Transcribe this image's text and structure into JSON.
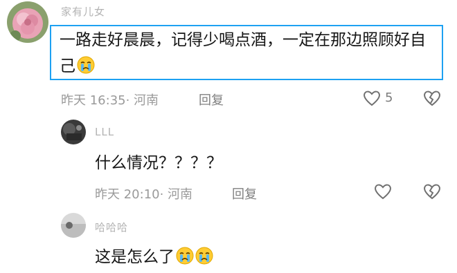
{
  "comment": {
    "username": "家有儿女",
    "text": "一路走好晨晨，记得少喝点酒，一定在那边照顾好自己",
    "time": "昨天 16:35",
    "location": "· 河南",
    "reply_label": "回复",
    "like_count": "5",
    "emoji": "crying-face"
  },
  "replies": [
    {
      "username": "LLL",
      "text": "什么情况？？？？",
      "time": "昨天 20:10",
      "location": "· 河南",
      "reply_label": "回复"
    },
    {
      "username": "哈哈哈",
      "text": "这是怎么了",
      "emojis": [
        "crying-face",
        "crying-face"
      ]
    }
  ],
  "colors": {
    "highlight_border": "#1da1f2",
    "text": "#161616",
    "meta": "#9a9a9a"
  }
}
